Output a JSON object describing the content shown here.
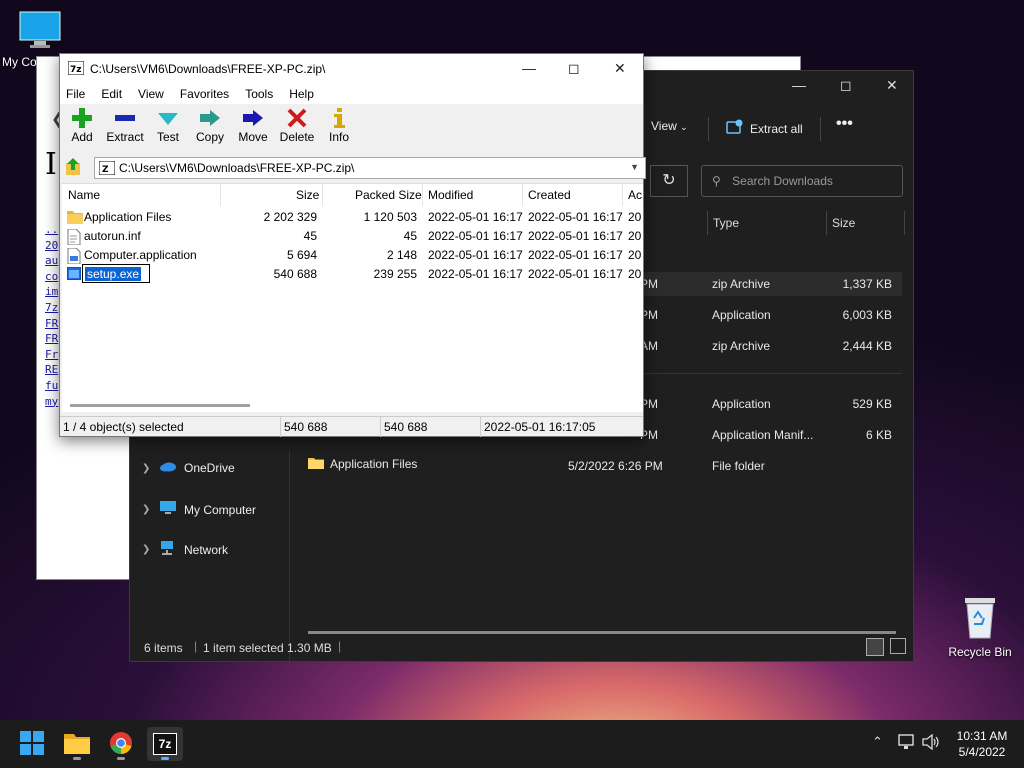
{
  "desktop": {
    "icons": [
      {
        "label": "My Co",
        "icon": "monitor-icon"
      },
      {
        "label": "Recycle Bin",
        "icon": "recycle-bin-icon"
      }
    ]
  },
  "paper_window": {
    "heading_letter": "I",
    "links": [
      "..",
      "20",
      "au",
      "co",
      "im",
      "7z",
      "FR",
      "FR",
      "Fr",
      "RE",
      "fu",
      "my"
    ]
  },
  "explorer": {
    "toolbar": {
      "view_label": "View",
      "extract_all_label": "Extract all",
      "more_label": "•••"
    },
    "search_placeholder": "Search Downloads",
    "columns": {
      "type": "Type",
      "size": "Size"
    },
    "rows": [
      {
        "date": "PM",
        "type": "zip Archive",
        "size": "1,337 KB",
        "selected": true
      },
      {
        "date": "PM",
        "type": "Application",
        "size": "6,003 KB"
      },
      {
        "date": "AM",
        "type": "zip Archive",
        "size": "2,444 KB"
      },
      {
        "date": "PM",
        "type": "Application",
        "size": "529 KB"
      },
      {
        "date": "PM",
        "type": "Application Manif...",
        "size": "6 KB"
      }
    ],
    "folder_row": {
      "name": "Application Files",
      "date": "5/2/2022 6:26 PM",
      "type": "File folder"
    },
    "sidebar": [
      {
        "label": "OneDrive",
        "icon": "onedrive-icon"
      },
      {
        "label": "My Computer",
        "icon": "monitor-icon"
      },
      {
        "label": "Network",
        "icon": "network-icon"
      }
    ],
    "status": {
      "items": "6 items",
      "selected": "1 item selected 1.30 MB"
    }
  },
  "sevenzip": {
    "title": "C:\\Users\\VM6\\Downloads\\FREE-XP-PC.zip\\",
    "menu": [
      "File",
      "Edit",
      "View",
      "Favorites",
      "Tools",
      "Help"
    ],
    "tools": [
      {
        "label": "Add",
        "icon": "plus-icon"
      },
      {
        "label": "Extract",
        "icon": "minus-icon"
      },
      {
        "label": "Test",
        "icon": "check-icon"
      },
      {
        "label": "Copy",
        "icon": "copy-arrow-icon"
      },
      {
        "label": "Move",
        "icon": "move-arrow-icon"
      },
      {
        "label": "Delete",
        "icon": "x-icon"
      },
      {
        "label": "Info",
        "icon": "info-icon"
      }
    ],
    "address": "C:\\Users\\VM6\\Downloads\\FREE-XP-PC.zip\\",
    "columns": {
      "name": "Name",
      "size": "Size",
      "packed": "Packed Size",
      "modified": "Modified",
      "created": "Created",
      "accessed": "Ac"
    },
    "rows": [
      {
        "name": "Application Files",
        "size": "2 202 329",
        "packed": "1 120 503",
        "modified": "2022-05-01 16:17",
        "created": "2022-05-01 16:17",
        "accessed": "20",
        "icon": "folder-icon"
      },
      {
        "name": "autorun.inf",
        "size": "45",
        "packed": "45",
        "modified": "2022-05-01 16:17",
        "created": "2022-05-01 16:17",
        "accessed": "20",
        "icon": "file-icon"
      },
      {
        "name": "Computer.application",
        "size": "5 694",
        "packed": "2 148",
        "modified": "2022-05-01 16:17",
        "created": "2022-05-01 16:17",
        "accessed": "20",
        "icon": "app-file-icon"
      },
      {
        "name": "setup.exe",
        "size": "540 688",
        "packed": "239 255",
        "modified": "2022-05-01 16:17",
        "created": "2022-05-01 16:17",
        "accessed": "20",
        "icon": "exe-icon",
        "editing": true
      }
    ],
    "status": {
      "selection": "1 / 4 object(s) selected",
      "size": "540 688",
      "packed": "540 688",
      "date": "2022-05-01 16:17:05"
    }
  },
  "taskbar": {
    "apps": [
      {
        "name": "start",
        "icon": "windows-logo-icon"
      },
      {
        "name": "file-explorer",
        "icon": "folder-icon"
      },
      {
        "name": "chrome",
        "icon": "chrome-icon"
      },
      {
        "name": "7-zip",
        "icon": "7zip-icon",
        "label": "7z"
      }
    ],
    "clock": {
      "time": "10:31 AM",
      "date": "5/4/2022"
    }
  },
  "colors": {
    "selection_blue": "#0a64d2",
    "explorer_bg": "#1f1f1f",
    "taskbar_bg": "#1c1c1c"
  }
}
